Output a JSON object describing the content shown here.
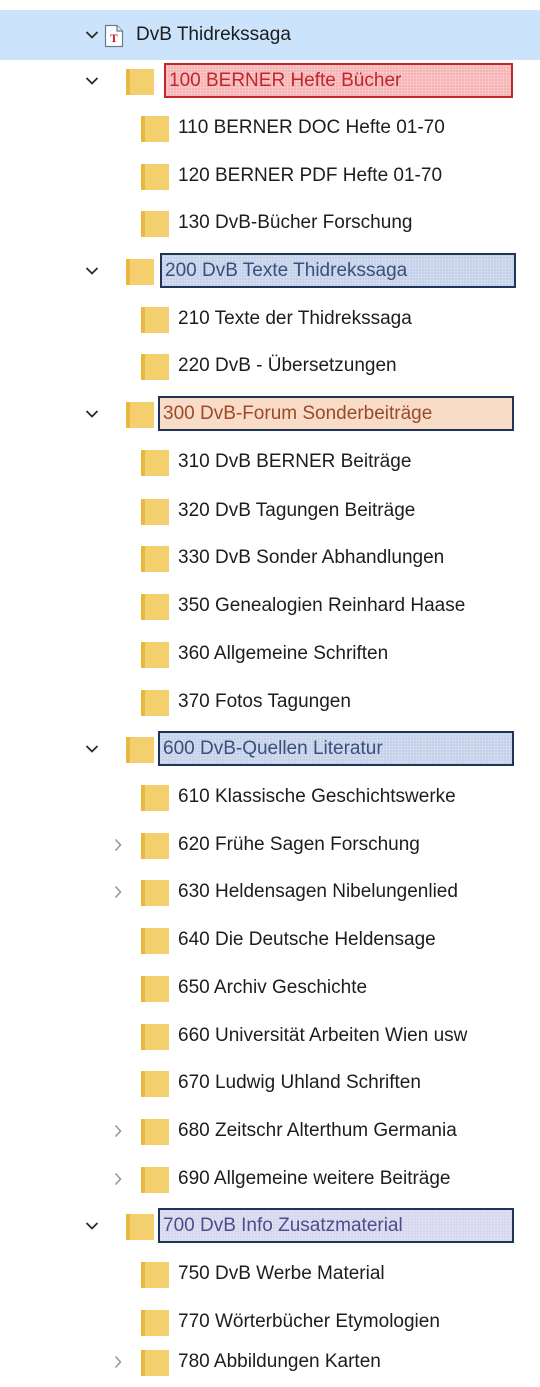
{
  "tree": {
    "root": {
      "label": "DvB Thidrekssaga",
      "icon": "text-file-icon",
      "expanded": true,
      "selected": true
    },
    "colors": {
      "selection": "#cce4fb",
      "folder": "#f3cf6e",
      "highlight_red": "#f6b4b6",
      "highlight_blue": "#c5d1ea",
      "highlight_peach": "#f9dcc8",
      "highlight_lilac": "#d6d6ee"
    },
    "groups": [
      {
        "label": "100 BERNER Hefte Bücher",
        "expanded": true,
        "highlight": "red",
        "children": [
          {
            "label": "110 BERNER DOC Hefte 01-70",
            "expandable": false
          },
          {
            "label": "120 BERNER PDF Hefte 01-70",
            "expandable": false
          },
          {
            "label": "130 DvB-Bücher Forschung",
            "expandable": false
          }
        ]
      },
      {
        "label": "200 DvB Texte Thidrekssaga",
        "expanded": true,
        "highlight": "blue",
        "children": [
          {
            "label": "210 Texte der Thidrekssaga",
            "expandable": false
          },
          {
            "label": "220 DvB - Übersetzungen",
            "expandable": false
          }
        ]
      },
      {
        "label": "300 DvB-Forum Sonderbeiträge",
        "expanded": true,
        "highlight": "peach",
        "children": [
          {
            "label": "310 DvB BERNER Beiträge",
            "expandable": false
          },
          {
            "label": "320 DvB Tagungen Beiträge",
            "expandable": false
          },
          {
            "label": "330 DvB Sonder Abhandlungen",
            "expandable": false
          },
          {
            "label": "350 Genealogien Reinhard Haase",
            "expandable": false
          },
          {
            "label": "360 Allgemeine Schriften",
            "expandable": false
          },
          {
            "label": "370 Fotos Tagungen",
            "expandable": false
          }
        ]
      },
      {
        "label": "600 DvB-Quellen Literatur",
        "expanded": true,
        "highlight": "blue",
        "children": [
          {
            "label": "610 Klassische Geschichtswerke",
            "expandable": false
          },
          {
            "label": "620 Frühe Sagen Forschung",
            "expandable": true
          },
          {
            "label": "630 Heldensagen Nibelungenlied",
            "expandable": true
          },
          {
            "label": "640 Die Deutsche Heldensage",
            "expandable": false
          },
          {
            "label": "650 Archiv Geschichte",
            "expandable": false
          },
          {
            "label": "660 Universität Arbeiten Wien usw",
            "expandable": false
          },
          {
            "label": "670 Ludwig Uhland Schriften",
            "expandable": false
          },
          {
            "label": "680 Zeitschr Alterthum Germania",
            "expandable": true
          },
          {
            "label": "690 Allgemeine weitere Beiträge",
            "expandable": true
          }
        ]
      },
      {
        "label": "700 DvB Info Zusatzmaterial",
        "expanded": true,
        "highlight": "lilac",
        "children": [
          {
            "label": "750 DvB Werbe Material",
            "expandable": false
          },
          {
            "label": "770 Wörterbücher Etymologien",
            "expandable": false
          },
          {
            "label": "780 Abbildungen Karten",
            "expandable": true
          }
        ]
      }
    ]
  }
}
